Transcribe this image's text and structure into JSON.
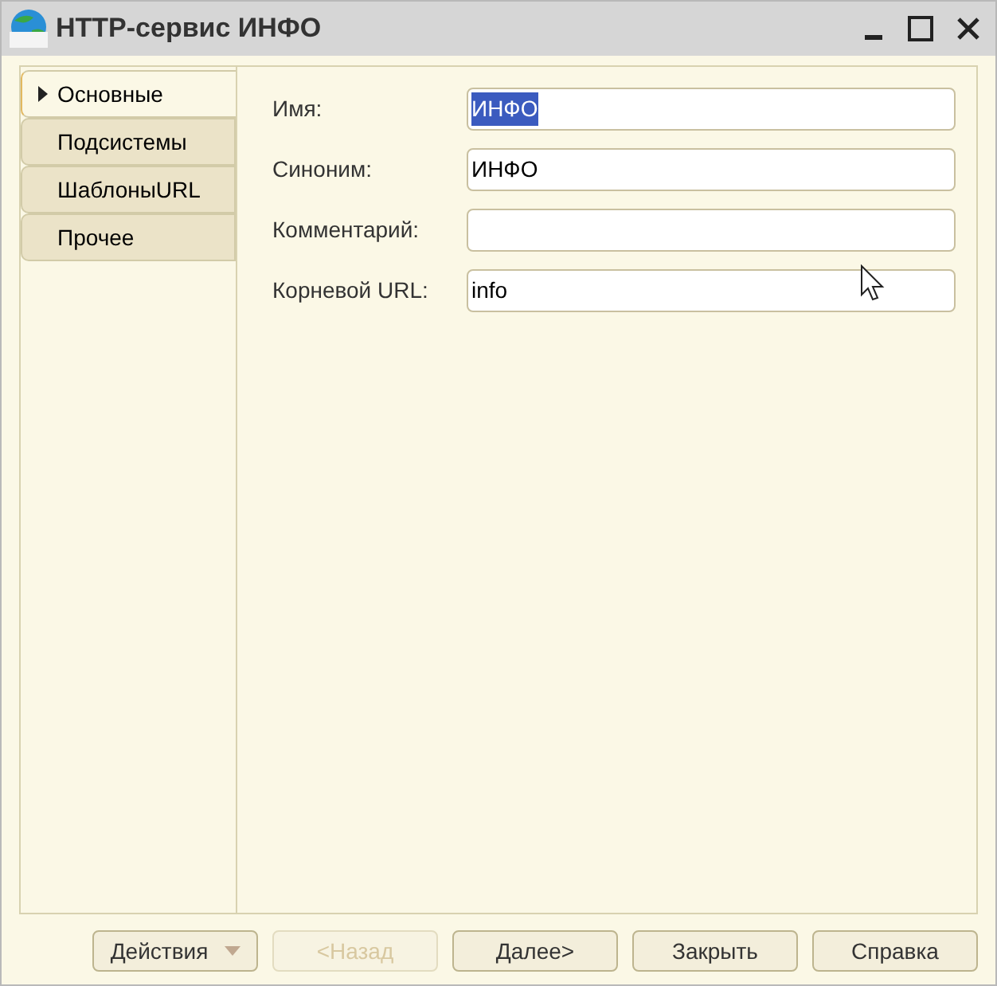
{
  "window": {
    "title": "HTTP-сервис ИНФО"
  },
  "tabs": [
    {
      "label": "Основные",
      "selected": true
    },
    {
      "label": "Подсистемы",
      "selected": false
    },
    {
      "label": "ШаблоныURL",
      "selected": false
    },
    {
      "label": "Прочее",
      "selected": false
    }
  ],
  "fields": [
    {
      "label": "Имя:",
      "value": "ИНФО",
      "text_selected": true
    },
    {
      "label": "Синоним:",
      "value": "ИНФО",
      "text_selected": false
    },
    {
      "label": "Комментарий:"
    },
    {
      "label": "Корневой URL:",
      "value": "info",
      "text_selected": false
    }
  ],
  "buttons": [
    {
      "label": "Действия",
      "kind": "dropdown",
      "disabled": false
    },
    {
      "label": "<Назад",
      "kind": "plain",
      "disabled": true
    },
    {
      "label": "Далее>",
      "kind": "plain",
      "disabled": false
    },
    {
      "label": "Закрыть",
      "kind": "plain",
      "disabled": false
    },
    {
      "label": "Справка",
      "kind": "plain",
      "disabled": false
    }
  ]
}
